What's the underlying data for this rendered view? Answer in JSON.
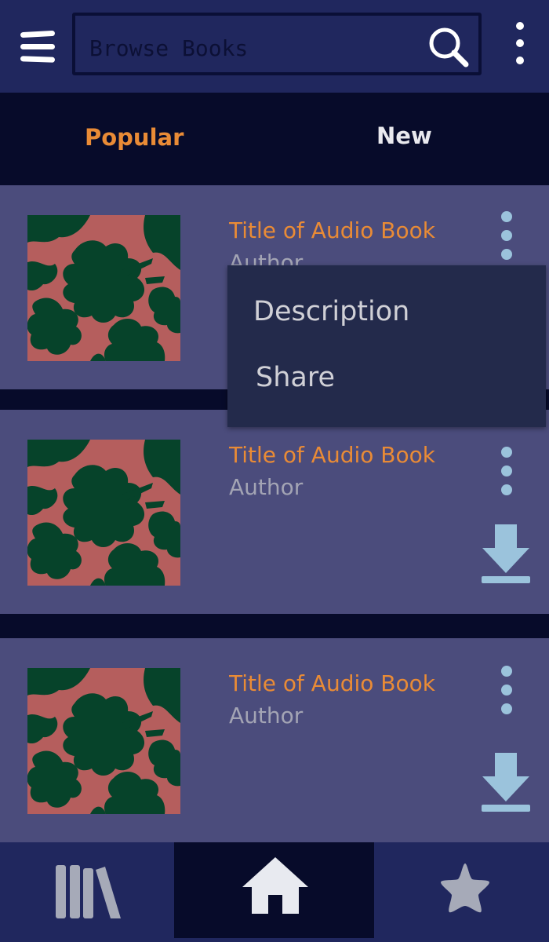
{
  "header": {
    "search_placeholder": "Browse Books",
    "menu_icon": "hamburger-icon",
    "search_icon": "search-icon",
    "more_icon": "more-vertical-icon"
  },
  "tabs": [
    {
      "label": "Popular",
      "active": true
    },
    {
      "label": "New",
      "active": false
    }
  ],
  "books": [
    {
      "title": "Title of Audio Book",
      "author": "Author"
    },
    {
      "title": "Title of Audio Book",
      "author": "Author"
    },
    {
      "title": "Title of Audio Book",
      "author": "Author"
    }
  ],
  "context_menu": {
    "items": [
      "Description",
      "Share"
    ]
  },
  "bottom_nav": {
    "items": [
      "library-icon",
      "home-icon",
      "star-icon"
    ],
    "active": "home-icon"
  },
  "colors": {
    "topbar": "#20275e",
    "background": "#070b2a",
    "card": "#4b4c7c",
    "accent": "#e98b36",
    "icon_light_blue": "#9bc3dc",
    "popup": "#232a4b"
  }
}
